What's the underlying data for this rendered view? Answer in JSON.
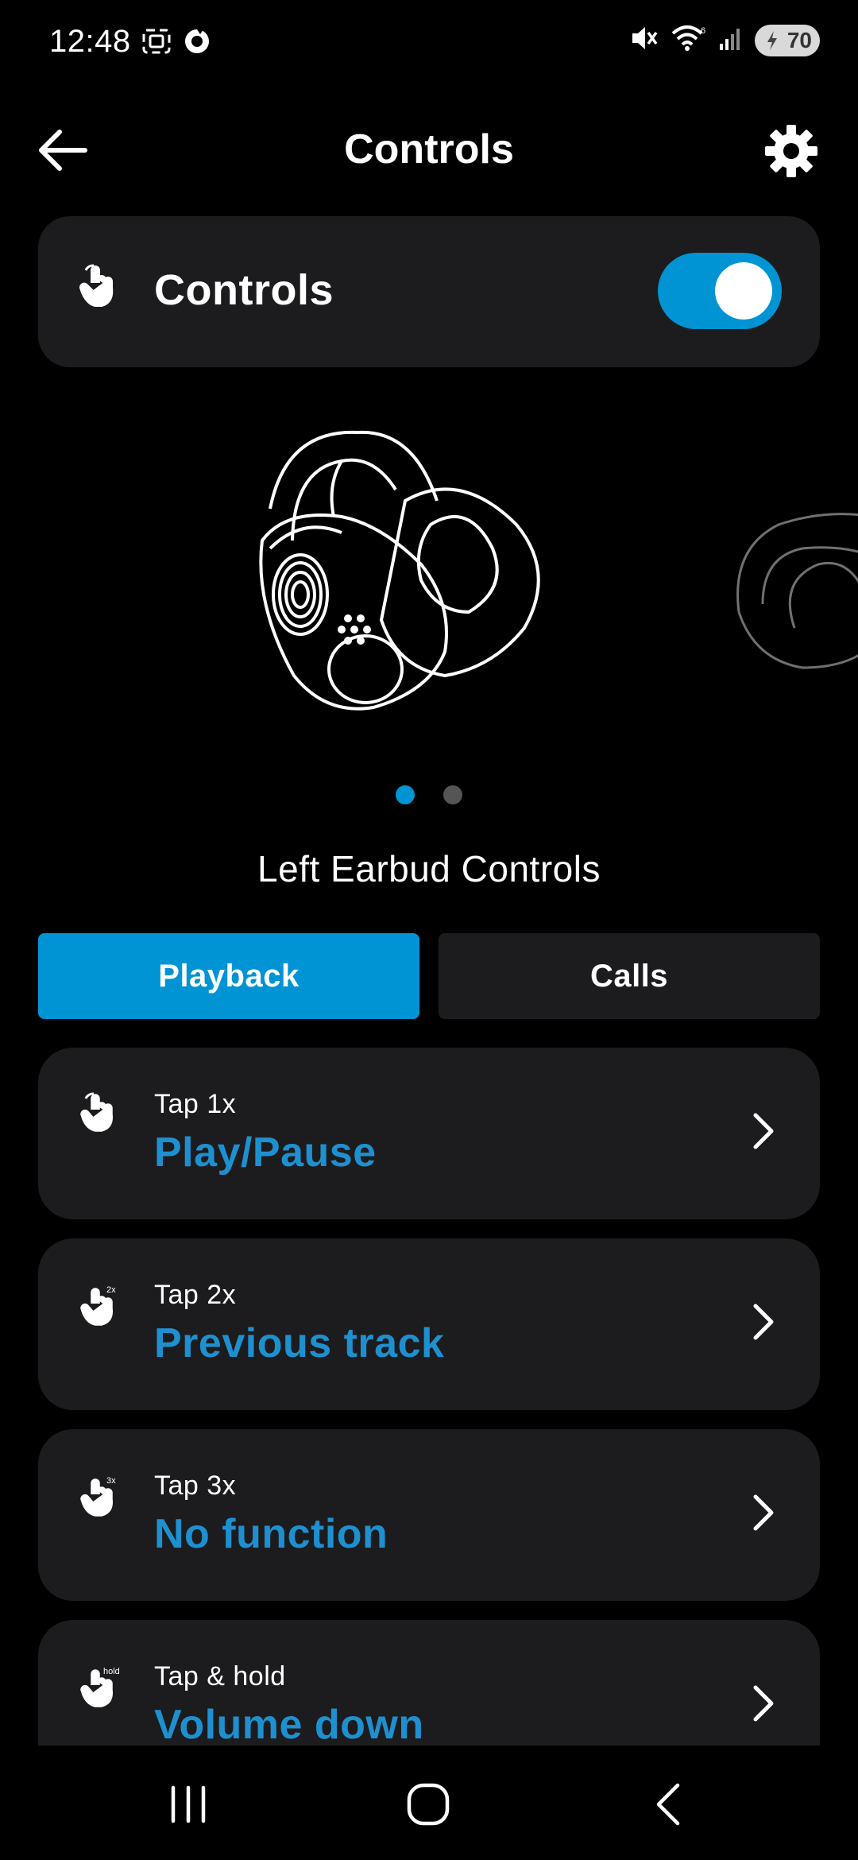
{
  "status_bar": {
    "time": "12:48",
    "battery": "70",
    "icons": [
      "screenshot-icon",
      "sync-icon",
      "mute-icon",
      "wifi-icon",
      "signal-icon",
      "battery-icon"
    ]
  },
  "header": {
    "title": "Controls",
    "back_icon": "arrow-left-icon",
    "settings_icon": "gear-icon"
  },
  "controls_toggle": {
    "label": "Controls",
    "enabled": true,
    "icon": "tap-hand-icon"
  },
  "carousel": {
    "pages": 2,
    "active_index": 0
  },
  "section_title": "Left Earbud Controls",
  "tabs": [
    {
      "label": "Playback",
      "active": true
    },
    {
      "label": "Calls",
      "active": false
    }
  ],
  "gestures": [
    {
      "label": "Tap 1x",
      "value": "Play/Pause",
      "badge": ""
    },
    {
      "label": "Tap 2x",
      "value": "Previous track",
      "badge": "2x"
    },
    {
      "label": "Tap 3x",
      "value": "No function",
      "badge": "3x"
    },
    {
      "label": "Tap & hold",
      "value": "Volume down",
      "badge": "hold"
    }
  ],
  "colors": {
    "accent": "#0094d4",
    "value_text": "#1e90d0",
    "card": "#1c1c1e",
    "background": "#000000"
  }
}
